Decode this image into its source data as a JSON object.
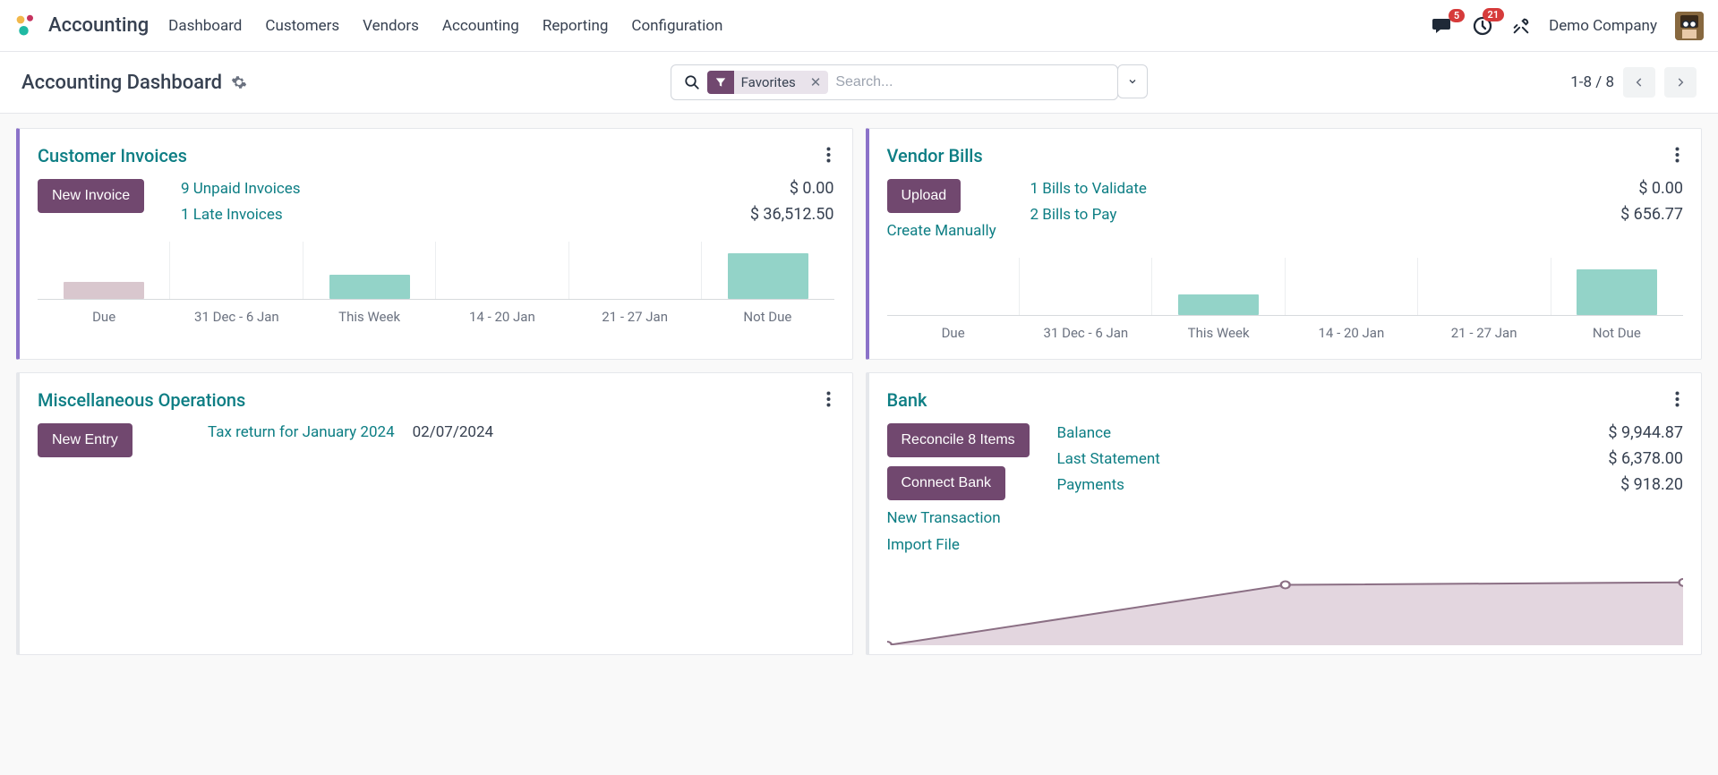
{
  "app_name": "Accounting",
  "nav": [
    "Dashboard",
    "Customers",
    "Vendors",
    "Accounting",
    "Reporting",
    "Configuration"
  ],
  "badges": {
    "messages": "5",
    "activities": "21"
  },
  "company": "Demo Company",
  "page_title": "Accounting Dashboard",
  "search": {
    "filter_label": "Favorites",
    "placeholder": "Search..."
  },
  "pager": "1-8 / 8",
  "chart_data": [
    {
      "type": "bar",
      "card": "customer_invoices",
      "categories": [
        "Due",
        "31 Dec - 6 Jan",
        "This Week",
        "14 - 20 Jan",
        "21 - 27 Jan",
        "Not Due"
      ],
      "values": [
        18,
        0,
        25,
        0,
        0,
        48
      ],
      "colors": [
        "#d9c7ce",
        null,
        "#93d3c8",
        null,
        null,
        "#93d3c8"
      ],
      "ylim": [
        0,
        60
      ]
    },
    {
      "type": "bar",
      "card": "vendor_bills",
      "categories": [
        "Due",
        "31 Dec - 6 Jan",
        "This Week",
        "14 - 20 Jan",
        "21 - 27 Jan",
        "Not Due"
      ],
      "values": [
        0,
        0,
        22,
        0,
        0,
        48
      ],
      "colors": [
        null,
        null,
        "#93d3c8",
        null,
        null,
        "#93d3c8"
      ],
      "ylim": [
        0,
        60
      ]
    },
    {
      "type": "area",
      "card": "bank",
      "x": [
        0,
        1,
        2
      ],
      "values": [
        0,
        75,
        78
      ],
      "ylim": [
        0,
        100
      ],
      "stroke": "#8b6f84",
      "fill": "#e3d6df"
    }
  ],
  "cards": {
    "customer_invoices": {
      "title": "Customer Invoices",
      "button": "New Invoice",
      "rows": [
        {
          "label": "9 Unpaid Invoices",
          "value": "$ 0.00"
        },
        {
          "label": "1 Late Invoices",
          "value": "$ 36,512.50"
        }
      ]
    },
    "vendor_bills": {
      "title": "Vendor Bills",
      "button": "Upload",
      "link": "Create Manually",
      "rows": [
        {
          "label": "1 Bills to Validate",
          "value": "$ 0.00"
        },
        {
          "label": "2 Bills to Pay",
          "value": "$ 656.77"
        }
      ]
    },
    "misc": {
      "title": "Miscellaneous Operations",
      "button": "New Entry",
      "row": {
        "label": "Tax return for January 2024",
        "date": "02/07/2024"
      }
    },
    "bank": {
      "title": "Bank",
      "button1": "Reconcile 8 Items",
      "button2": "Connect Bank",
      "link1": "New Transaction",
      "link2": "Import File",
      "rows": [
        {
          "label": "Balance",
          "value": "$ 9,944.87"
        },
        {
          "label": "Last Statement",
          "value": "$ 6,378.00"
        },
        {
          "label": "Payments",
          "value": "$ 918.20"
        }
      ]
    }
  }
}
